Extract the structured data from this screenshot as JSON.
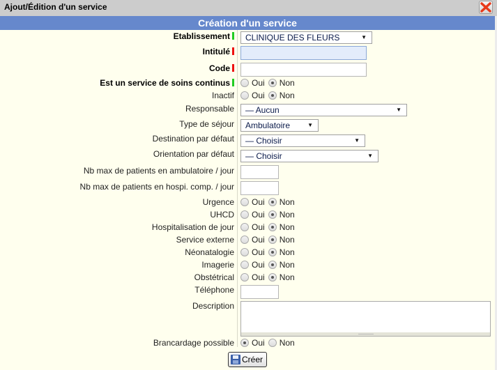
{
  "window": {
    "title": "Ajout/Édition d'un service",
    "close_icon": "close-icon"
  },
  "form": {
    "heading": "Création d'un service",
    "etablissement": {
      "label": "Etablissement",
      "value": "CLINIQUE DES FLEURS",
      "indicator": "green"
    },
    "intitule": {
      "label": "Intitulé",
      "value": "",
      "indicator": "red"
    },
    "code": {
      "label": "Code",
      "value": "",
      "indicator": "red"
    },
    "soins_continus": {
      "label": "Est un service de soins continus",
      "indicator": "green",
      "selected": "Non"
    },
    "inactif": {
      "label": "Inactif",
      "selected": "Non"
    },
    "responsable": {
      "label": "Responsable",
      "value": "— Aucun"
    },
    "type_sejour": {
      "label": "Type de séjour",
      "value": "Ambulatoire"
    },
    "destination": {
      "label": "Destination par défaut",
      "value": "— Choisir"
    },
    "orientation": {
      "label": "Orientation par défaut",
      "value": "— Choisir"
    },
    "nb_ambu": {
      "label": "Nb max de patients en ambulatoire / jour",
      "value": ""
    },
    "nb_hospi": {
      "label": "Nb max de patients en hospi. comp. / jour",
      "value": ""
    },
    "urgence": {
      "label": "Urgence",
      "selected": "Non"
    },
    "uhcd": {
      "label": "UHCD",
      "selected": "Non"
    },
    "hospi_jour": {
      "label": "Hospitalisation de jour",
      "selected": "Non"
    },
    "externe": {
      "label": "Service externe",
      "selected": "Non"
    },
    "neonat": {
      "label": "Néonatalogie",
      "selected": "Non"
    },
    "imagerie": {
      "label": "Imagerie",
      "selected": "Non"
    },
    "obstetrical": {
      "label": "Obstétrical",
      "selected": "Non"
    },
    "telephone": {
      "label": "Téléphone",
      "value": ""
    },
    "description": {
      "label": "Description",
      "value": ""
    },
    "brancardage": {
      "label": "Brancardage possible",
      "selected": "Oui"
    },
    "oui": "Oui",
    "non": "Non",
    "submit_label": "Créer",
    "colors": {
      "header": "#6688cc",
      "background": "#ffffee",
      "required": "#ee1111",
      "ok": "#22cc22"
    }
  }
}
